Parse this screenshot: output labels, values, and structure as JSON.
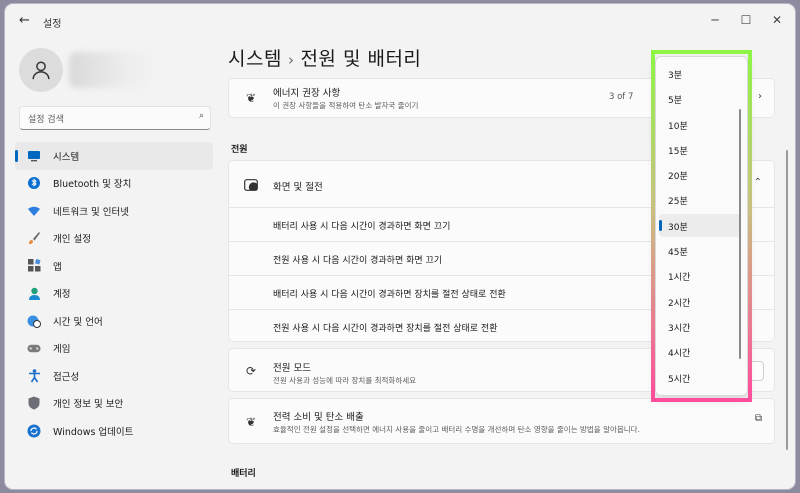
{
  "titlebar": {
    "app_title": "설정",
    "back": "←",
    "minimize": "─",
    "maximize": "☐",
    "close": "✕"
  },
  "sidebar": {
    "search_placeholder": "설정 검색",
    "items": [
      {
        "label": "시스템",
        "icon": "monitor-icon",
        "selected": true
      },
      {
        "label": "Bluetooth 및 장치",
        "icon": "bluetooth-icon"
      },
      {
        "label": "네트워크 및 인터넷",
        "icon": "wifi-icon"
      },
      {
        "label": "개인 설정",
        "icon": "brush-icon"
      },
      {
        "label": "앱",
        "icon": "apps-icon"
      },
      {
        "label": "계정",
        "icon": "person-icon"
      },
      {
        "label": "시간 및 언어",
        "icon": "globe-clock-icon"
      },
      {
        "label": "게임",
        "icon": "gamepad-icon"
      },
      {
        "label": "접근성",
        "icon": "accessibility-icon"
      },
      {
        "label": "개인 정보 및 보안",
        "icon": "shield-icon"
      },
      {
        "label": "Windows 업데이트",
        "icon": "update-icon"
      }
    ]
  },
  "main": {
    "breadcrumb_parent": "시스템",
    "breadcrumb_sep": "›",
    "page_title": "전원 및 배터리",
    "energy": {
      "title": "에너지 권장 사항",
      "subtitle": "이 권장 사항들을 적용하여 탄소 발자국 줄이기",
      "count": "3 of 7"
    },
    "section_power": "전원",
    "screen_sleep": {
      "title": "화면 및 절전",
      "rows": [
        "배터리 사용 시 다음 시간이 경과하면 화면 끄기",
        "전원 사용 시 다음 시간이 경과하면 화면 끄기",
        "배터리 사용 시 다음 시간이 경과하면 장치를 절전 상태로 전환",
        "전원 사용 시 다음 시간이 경과하면 장치를 절전 상태로 전환"
      ]
    },
    "power_mode": {
      "title": "전원 모드",
      "subtitle": "전원 사용과 성능에 따라 장치를 최적화하세요"
    },
    "power_usage": {
      "title": "전력 소비 및 탄소 배출",
      "subtitle": "효율적인 전원 설정을 선택하면 에너지 사용을 줄이고 배터리 수명을 개선하며 탄소 영향을 줄이는 방법을 알아봅니다."
    },
    "section_battery": "배터리"
  },
  "dropdown": {
    "options": [
      "3분",
      "5분",
      "10분",
      "15분",
      "20분",
      "25분",
      "30분",
      "45분",
      "1시간",
      "2시간",
      "3시간",
      "4시간",
      "5시간"
    ],
    "selected": "30분"
  },
  "colors": {
    "accent": "#0067c0",
    "highlight_top": "#8ef545",
    "highlight_bottom": "#ff4d9c"
  }
}
